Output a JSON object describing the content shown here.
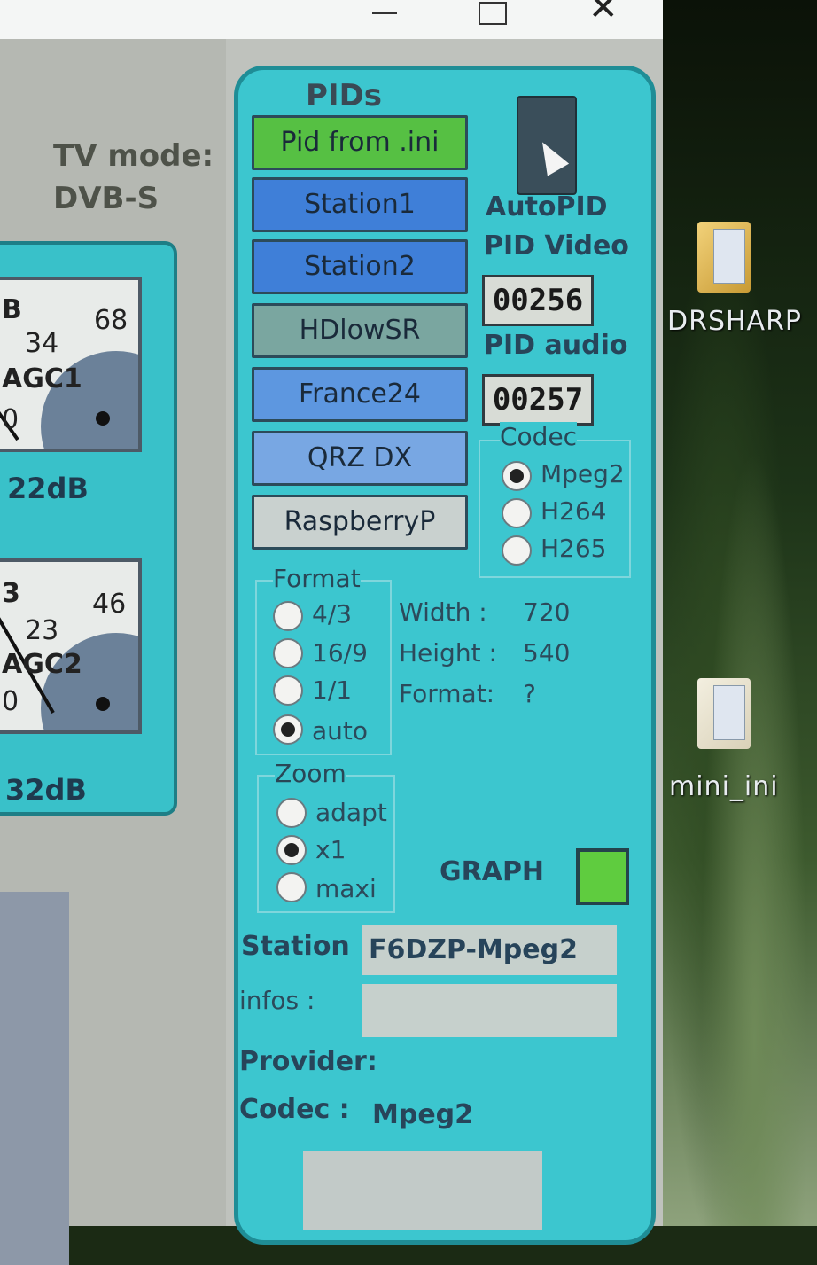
{
  "window": {
    "title_buttons": {
      "minimize": "",
      "maximize": "",
      "close": "✕"
    }
  },
  "left": {
    "tv_mode_label": "TV mode:",
    "tv_mode_value": "DVB-S",
    "meter1": {
      "scale_left": "B",
      "scale_mid": "34",
      "scale_right": "68",
      "name": "AGC1",
      "zero": "0",
      "db": "22dB"
    },
    "meter2": {
      "scale_left": "3",
      "scale_mid": "23",
      "scale_right": "46",
      "name": "AGC2",
      "zero": "0",
      "db": "32dB"
    }
  },
  "pids": {
    "title": "PIDs",
    "buttons": [
      {
        "label": "Pid from .ini",
        "color": "#56c043"
      },
      {
        "label": "Station1",
        "color": "#3f7fd8"
      },
      {
        "label": "Station2",
        "color": "#3f7fd8"
      },
      {
        "label": "HDlowSR",
        "color": "#7aa6a0"
      },
      {
        "label": "France24",
        "color": "#5d97e0"
      },
      {
        "label": "QRZ DX",
        "color": "#78a7e3"
      },
      {
        "label": "RaspberryP",
        "color": "#c9d1cf"
      }
    ],
    "autopid_label": "AutoPID",
    "autopid_icon": "cursor-pointer-icon",
    "pid_video_label": "PID Video",
    "pid_video_value": "00256",
    "pid_audio_label": "PID  audio",
    "pid_audio_value": "00257",
    "codec": {
      "title": "Codec",
      "options": [
        "Mpeg2",
        "H264",
        "H265"
      ],
      "selected": "Mpeg2"
    },
    "format": {
      "title": "Format",
      "options": [
        "4/3",
        "16/9",
        "1/1",
        "auto"
      ],
      "selected": "auto"
    },
    "video_info": {
      "width_label": "Width :",
      "width_value": "720",
      "height_label": "Height :",
      "height_value": "540",
      "format_label": "Format:",
      "format_value": "?"
    },
    "zoom": {
      "title": "Zoom",
      "options": [
        "adapt",
        "x1",
        "maxi"
      ],
      "selected": "x1"
    },
    "graph_label": "GRAPH",
    "station_label": "Station",
    "station_value": "F6DZP-Mpeg2",
    "infos_label": "infos :",
    "infos_value": "",
    "provider_label": "Provider:",
    "codec_label": "Codec  :",
    "codec_value": "Mpeg2"
  },
  "desktop": {
    "icons": [
      {
        "label": "DRSHARP"
      },
      {
        "label": "mini_ini"
      }
    ]
  }
}
